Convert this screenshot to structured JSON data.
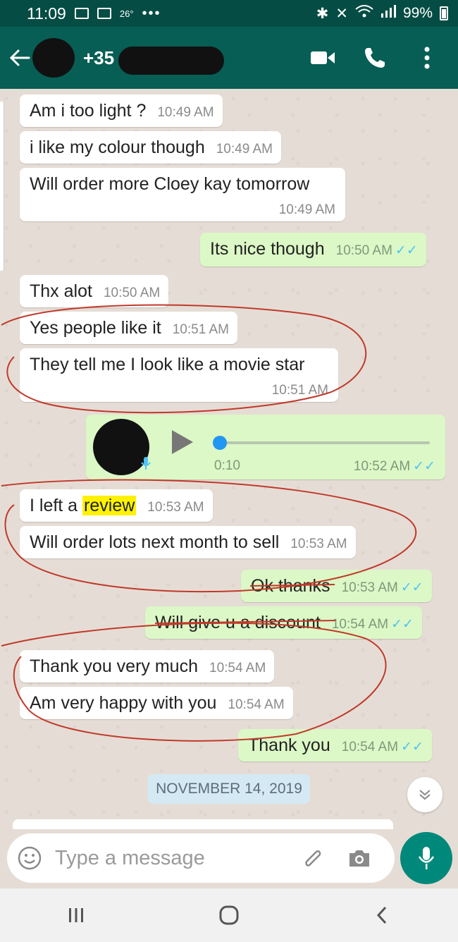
{
  "status_bar": {
    "time": "11:09",
    "temp": "26°",
    "overflow": "•••",
    "battery": "99%"
  },
  "header": {
    "contact_number": "+35",
    "icons": [
      "back-arrow-icon",
      "video-call-icon",
      "phone-icon",
      "more-vert-icon"
    ]
  },
  "messages": [
    {
      "dir": "in",
      "text": "Am i too light ?",
      "time": "10:49 AM"
    },
    {
      "dir": "in",
      "text": "i like my colour though",
      "time": "10:49 AM"
    },
    {
      "dir": "in",
      "text": "Will order more Cloey kay tomorrow",
      "time": "10:49 AM"
    },
    {
      "dir": "out",
      "text": "Its nice though",
      "time": "10:50 AM"
    },
    {
      "dir": "in",
      "text": "Thx alot",
      "time": "10:50 AM"
    },
    {
      "dir": "in",
      "text": "Yes people like it",
      "time": "10:51 AM"
    },
    {
      "dir": "in",
      "text": "They tell me I look like a movie star",
      "time": "10:51 AM"
    },
    {
      "dir": "out",
      "type": "voice",
      "duration": "0:10",
      "time": "10:52 AM"
    },
    {
      "dir": "in",
      "text_before": "I left a ",
      "text_highlight": "review",
      "time": "10:53 AM"
    },
    {
      "dir": "in",
      "text": "Will order lots next month to sell",
      "time": "10:53 AM"
    },
    {
      "dir": "out",
      "text": "Ok thanks",
      "time": "10:53 AM"
    },
    {
      "dir": "out",
      "text": "Will give u a discount",
      "time": "10:54 AM"
    },
    {
      "dir": "in",
      "text": "Thank you very much",
      "time": "10:54 AM"
    },
    {
      "dir": "in",
      "text": "Am very happy with you",
      "time": "10:54 AM"
    },
    {
      "dir": "out",
      "text": "Thank you",
      "time": "10:54 AM"
    }
  ],
  "read_receipt": "✓✓",
  "date_divider": "NOVEMBER 14, 2019",
  "composer": {
    "placeholder": "Type a message"
  },
  "colors": {
    "header": "#075e54",
    "statusbar": "#054d44",
    "outgoing": "#dcf8c6",
    "incoming": "#ffffff",
    "accent": "#00897b",
    "tick": "#4fc3f7",
    "highlight": "#fff200",
    "annotation": "#c0392b"
  }
}
